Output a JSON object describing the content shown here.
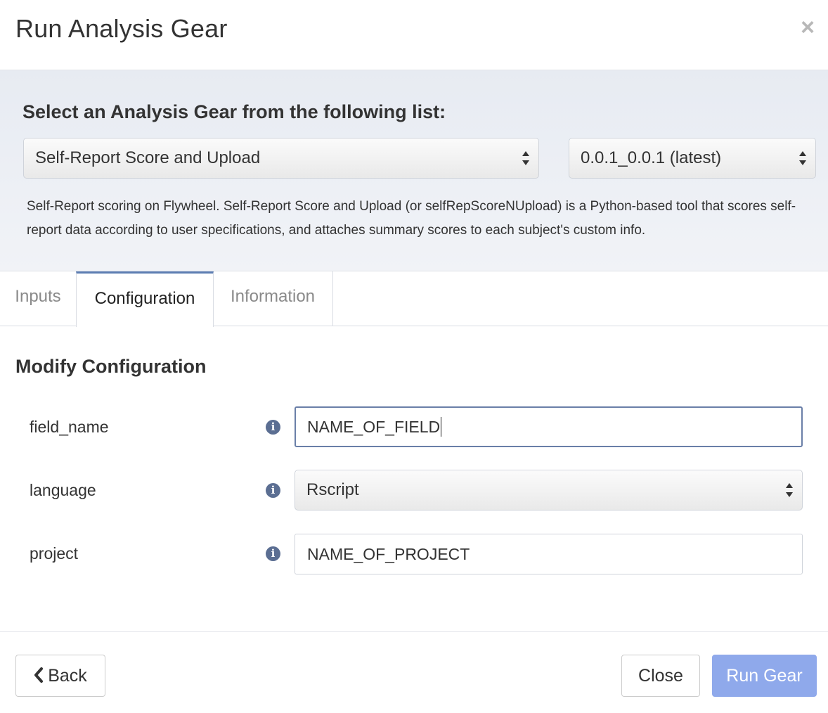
{
  "modal": {
    "title": "Run Analysis Gear",
    "close_glyph": "×"
  },
  "gear_selection": {
    "heading": "Select an Analysis Gear from the following list:",
    "gear": "Self-Report Score and Upload",
    "version": "0.0.1_0.0.1 (latest)",
    "description": "Self-Report scoring on Flywheel. Self-Report Score and Upload (or selfRepScoreNUpload) is a Python-based tool that scores self-report data according to user specifications, and attaches summary scores to each subject's custom info."
  },
  "tabs": [
    {
      "label": "Inputs",
      "active": false
    },
    {
      "label": "Configuration",
      "active": true
    },
    {
      "label": "Information",
      "active": false
    }
  ],
  "configuration": {
    "title": "Modify Configuration",
    "fields": [
      {
        "label": "field_name",
        "value": "NAME_OF_FIELD",
        "type": "text",
        "focused": true
      },
      {
        "label": "language",
        "value": "Rscript",
        "type": "select"
      },
      {
        "label": "project",
        "value": "NAME_OF_PROJECT",
        "type": "text"
      }
    ],
    "info_glyph": "i"
  },
  "footer": {
    "back_label": "Back",
    "close_label": "Close",
    "run_label": "Run Gear"
  },
  "colors": {
    "active_tab_border": "#5c7db2",
    "run_button": "#8fa9eb",
    "info_icon": "#5b6e92",
    "panel_bg": "#e7ebf2"
  },
  "icons": [
    "close-icon",
    "select-arrows-icon",
    "info-icon",
    "chevron-left-icon"
  ]
}
